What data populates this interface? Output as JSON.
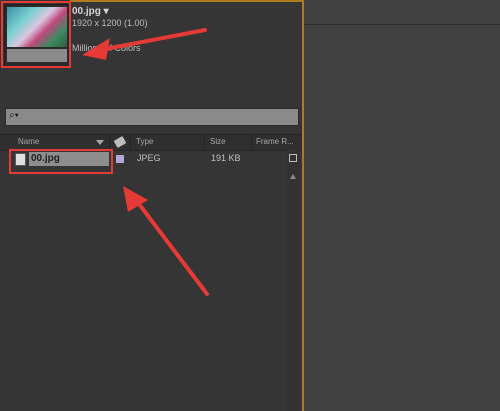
{
  "preview": {
    "file_title": "00.jpg ▾",
    "dimensions": "1920 x 1200 (1.00)",
    "colors": "Millions of Colors"
  },
  "search": {
    "placeholder": ""
  },
  "columns": {
    "name": "Name",
    "type": "Type",
    "size": "Size",
    "frame_rate": "Frame R..."
  },
  "rows": [
    {
      "name": "00.jpg",
      "type": "JPEG",
      "size": "191 KB"
    }
  ],
  "colors": {
    "annotation_red": "#e53a35",
    "label_lavender": "#b4a6d8",
    "panel_accent": "#b07a1f"
  }
}
